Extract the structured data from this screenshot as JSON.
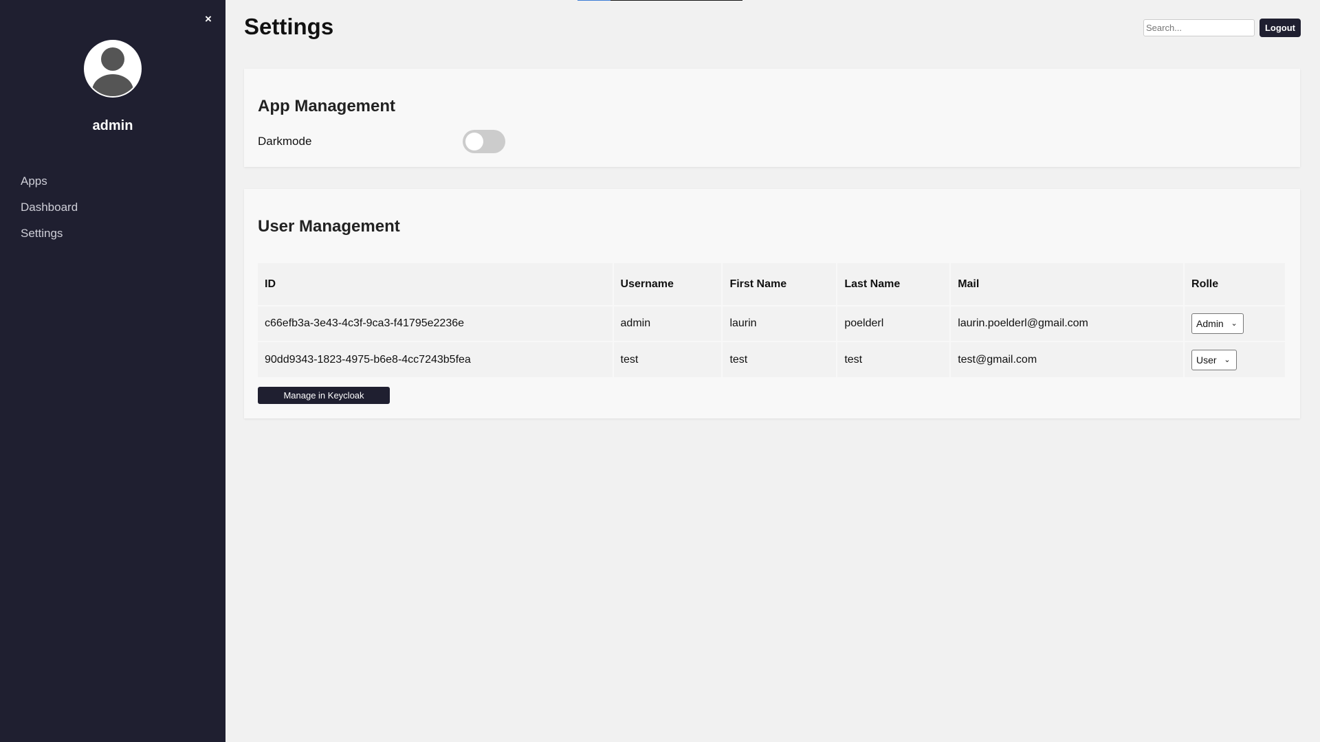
{
  "sidebar": {
    "close_label": "×",
    "username": "admin",
    "items": [
      {
        "label": "Apps"
      },
      {
        "label": "Dashboard"
      },
      {
        "label": "Settings"
      }
    ]
  },
  "header": {
    "title": "Settings",
    "search_placeholder": "Search...",
    "logout_label": "Logout"
  },
  "app_management": {
    "title": "App Management",
    "darkmode_label": "Darkmode",
    "darkmode_enabled": false
  },
  "user_management": {
    "title": "User Management",
    "columns": [
      "ID",
      "Username",
      "First Name",
      "Last Name",
      "Mail",
      "Rolle"
    ],
    "rows": [
      {
        "id": "c66efb3a-3e43-4c3f-9ca3-f41795e2236e",
        "username": "admin",
        "first_name": "laurin",
        "last_name": "poelderl",
        "mail": "laurin.poelderl@gmail.com",
        "role": "Admin"
      },
      {
        "id": "90dd9343-1823-4975-b6e8-4cc7243b5fea",
        "username": "test",
        "first_name": "test",
        "last_name": "test",
        "mail": "test@gmail.com",
        "role": "User"
      }
    ],
    "manage_button_label": "Manage in Keycloak"
  },
  "colors": {
    "sidebar_bg": "#1f1f30",
    "page_bg": "#f1f1f1",
    "accent": "#3a7bd5"
  }
}
